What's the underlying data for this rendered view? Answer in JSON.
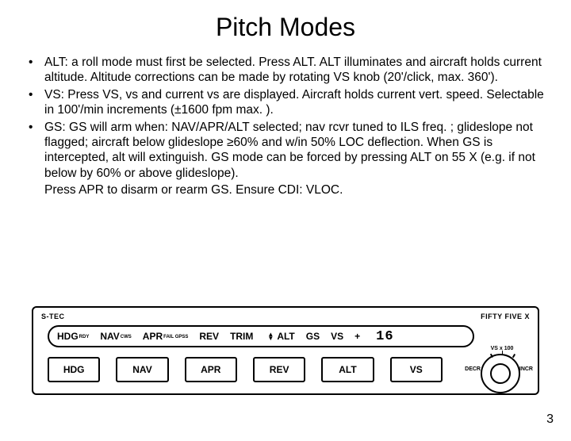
{
  "title": "Pitch Modes",
  "bullets": [
    "ALT: a roll mode must first be selected. Press ALT. ALT illuminates and aircraft holds current altitude. Altitude corrections can be made by rotating VS knob (20'/click, max. 360').",
    "VS: Press VS, vs and current vs are displayed. Aircraft holds current vert. speed. Selectable in 100'/min increments (±1600 fpm max. ).",
    "GS: GS will arm when: NAV/APR/ALT selected; nav rcvr tuned to ILS freq. ; glideslope not flagged; aircraft below glideslope ≥60% and w/in 50% LOC deflection. When GS is intercepted, alt will extinguish. GS mode can be forced by pressing ALT on 55 X (e.g. if not below by 60% or above glideslope)."
  ],
  "indent_line": "Press APR to disarm or rearm GS.  Ensure CDI: VLOC.",
  "panel": {
    "brand_left": "S-TEC",
    "brand_right": "FIFTY FIVE X",
    "lcd": {
      "hdg": "HDG",
      "hdg_sub": "RDY",
      "nav": "NAV",
      "nav_sub": "CWS",
      "apr": "APR",
      "apr_sub": "FAIL GPSS",
      "rev": "REV",
      "trim": "TRIM",
      "alt": "ALT",
      "gs": "GS",
      "vs": "VS",
      "sign": "+",
      "digits": "16"
    },
    "buttons": [
      "HDG",
      "NAV",
      "APR",
      "REV",
      "ALT",
      "VS"
    ],
    "knob": {
      "top": "VS x 100",
      "left": "DECR",
      "right": "INCR"
    }
  },
  "page_number": "3"
}
